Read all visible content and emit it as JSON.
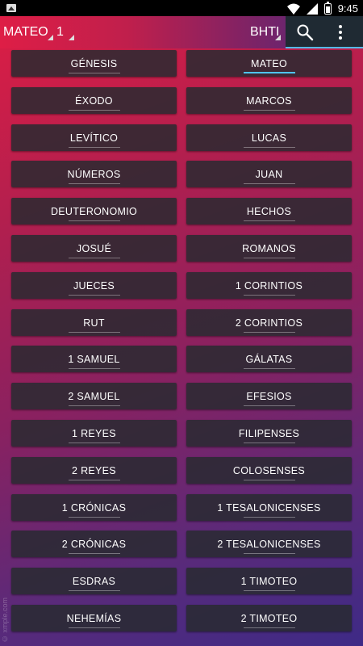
{
  "status": {
    "time": "9:45"
  },
  "toolbar": {
    "book": "MATEO",
    "chapter": "1",
    "version": "BHTI",
    "search_icon": "search-icon",
    "menu_icon": "more-vert-icon"
  },
  "books": {
    "old": [
      "GÉNESIS",
      "ÉXODO",
      "LEVÍTICO",
      "NÚMEROS",
      "DEUTERONOMIO",
      "JOSUÉ",
      "JUECES",
      "RUT",
      "1 SAMUEL",
      "2 SAMUEL",
      "1 REYES",
      "2 REYES",
      "1 CRÓNICAS",
      "2 CRÓNICAS",
      "ESDRAS",
      "NEHEMÍAS"
    ],
    "new": [
      "MATEO",
      "MARCOS",
      "LUCAS",
      "JUAN",
      "HECHOS",
      "ROMANOS",
      "1 CORINTIOS",
      "2 CORINTIOS",
      "GÁLATAS",
      "EFESIOS",
      "FILIPENSES",
      "COLOSENSES",
      "1 TESALONICENSES",
      "2 TESALONICENSES",
      "1 TIMOTEO",
      "2 TIMOTEO"
    ],
    "selected": "MATEO"
  },
  "watermark": "© xmple.com",
  "colors": {
    "accent": "#4fc3f7",
    "button_bg": "#2a2c31"
  }
}
